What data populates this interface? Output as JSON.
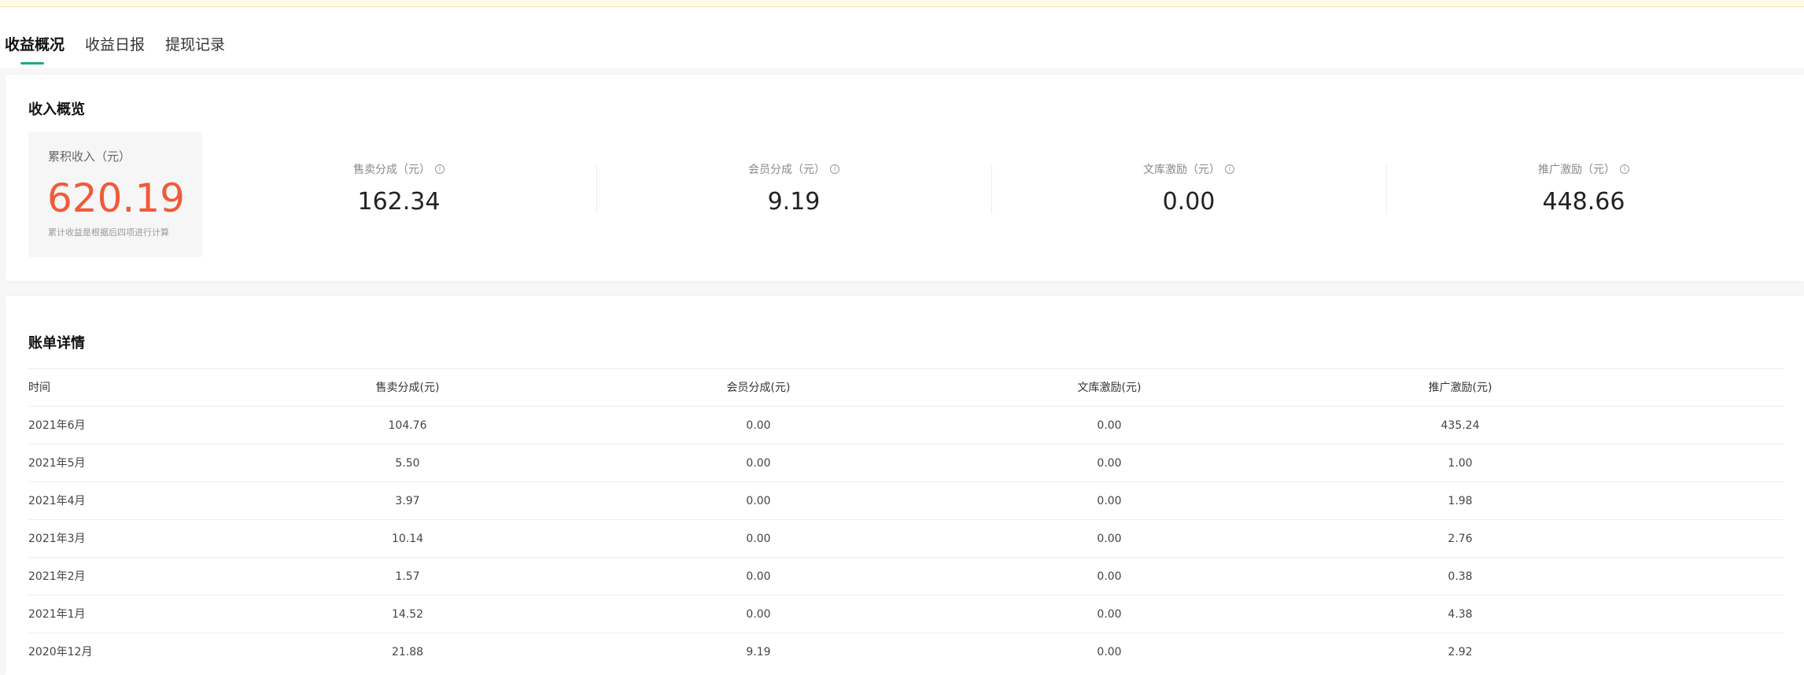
{
  "tabs": [
    {
      "label": "收益概况",
      "active": true
    },
    {
      "label": "收益日报",
      "active": false
    },
    {
      "label": "提现记录",
      "active": false
    }
  ],
  "overview": {
    "title": "收入概览",
    "total": {
      "label": "累积收入（元）",
      "value": "620.19",
      "note": "累计收益是根据后四项进行计算"
    },
    "stats": [
      {
        "label": "售卖分成（元）",
        "value": "162.34"
      },
      {
        "label": "会员分成（元）",
        "value": "9.19"
      },
      {
        "label": "文库激励（元）",
        "value": "0.00"
      },
      {
        "label": "推广激励（元）",
        "value": "448.66"
      }
    ]
  },
  "details": {
    "title": "账单详情",
    "columns": [
      "时间",
      "售卖分成(元)",
      "会员分成(元)",
      "文库激励(元)",
      "推广激励(元)"
    ],
    "rows": [
      [
        "2021年6月",
        "104.76",
        "0.00",
        "0.00",
        "435.24"
      ],
      [
        "2021年5月",
        "5.50",
        "0.00",
        "0.00",
        "1.00"
      ],
      [
        "2021年4月",
        "3.97",
        "0.00",
        "0.00",
        "1.98"
      ],
      [
        "2021年3月",
        "10.14",
        "0.00",
        "0.00",
        "2.76"
      ],
      [
        "2021年2月",
        "1.57",
        "0.00",
        "0.00",
        "0.38"
      ],
      [
        "2021年1月",
        "14.52",
        "0.00",
        "0.00",
        "4.38"
      ],
      [
        "2020年12月",
        "21.88",
        "9.19",
        "0.00",
        "2.92"
      ]
    ]
  },
  "colors": {
    "accent": "#1aae78",
    "total_value": "#f05a3a"
  }
}
